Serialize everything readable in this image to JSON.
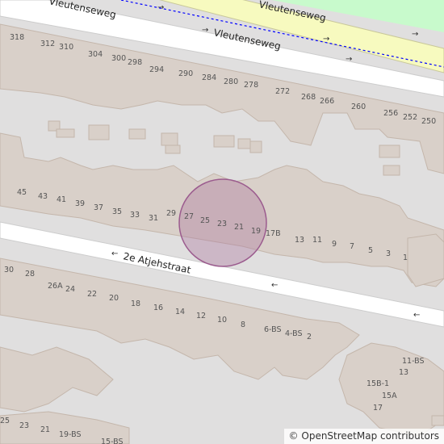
{
  "map": {
    "streets": [
      {
        "id": "vleutenseweg-top",
        "name": "Vleutenseweg"
      },
      {
        "id": "vleutenseweg",
        "name": "Vleutenseweg"
      },
      {
        "id": "vleutenseweg-cycle",
        "name": "Vleutenseweg"
      },
      {
        "id": "atjehstraat",
        "name": "2e Atjehstraat"
      }
    ],
    "house_numbers": [
      "318",
      "312",
      "310",
      "304",
      "300",
      "298",
      "294",
      "290",
      "284",
      "280",
      "278",
      "272",
      "268",
      "266",
      "260",
      "256",
      "252",
      "250",
      "45",
      "43",
      "41",
      "39",
      "37",
      "35",
      "33",
      "31",
      "29",
      "27",
      "25",
      "23",
      "21",
      "19",
      "17B",
      "13",
      "11",
      "9",
      "7",
      "5",
      "3",
      "1",
      "30",
      "28",
      "26A",
      "24",
      "22",
      "20",
      "18",
      "16",
      "14",
      "12",
      "10",
      "8",
      "6-BS",
      "4-BS",
      "2",
      "11-BS",
      "13",
      "15B-1",
      "15A",
      "17",
      "25",
      "23",
      "21",
      "19-BS",
      "15-BS"
    ],
    "highlight": {
      "shape": "circle",
      "fill": "#b07aa1"
    },
    "colors": {
      "background": "#e0dfdf",
      "building": "#d9d0c9",
      "building_stroke": "#c4b6ab",
      "road": "#ffffff",
      "primary_road": "#f7fabf",
      "cycleway": "#0000ff",
      "landuse": "#c8facc"
    }
  },
  "attribution": {
    "symbol": "©",
    "text": "OpenStreetMap contributors"
  }
}
